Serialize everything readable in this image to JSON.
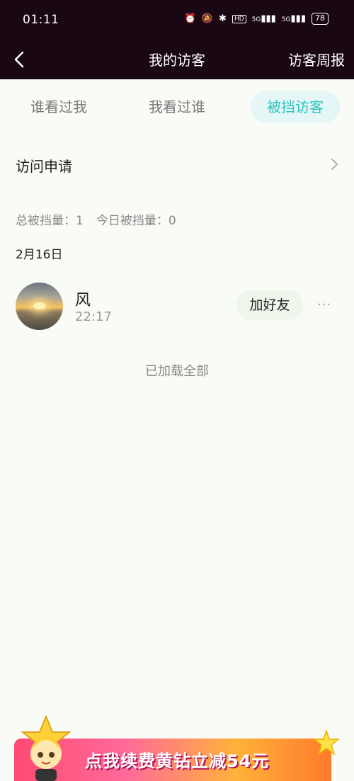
{
  "status_bar": {
    "time": "01:11",
    "network1": "5G",
    "network2": "5G",
    "battery": "78"
  },
  "nav": {
    "title": "我的访客",
    "right_label": "访客周报"
  },
  "tabs": [
    {
      "label": "谁看过我",
      "active": false
    },
    {
      "label": "我看过谁",
      "active": false
    },
    {
      "label": "被挡访客",
      "active": true
    }
  ],
  "request": {
    "label": "访问申请"
  },
  "stats": {
    "total": "总被挡量：1",
    "today": "今日被挡量：0"
  },
  "date_header": "2月16日",
  "visitor": {
    "name": "风",
    "time": "22:17",
    "add_label": "加好友",
    "more_label": "···"
  },
  "footer_text": "已加载全部",
  "banner": {
    "text": "点我续费黄钻立减54元"
  },
  "colors": {
    "header_bg": "#190713",
    "active_tab": "#2ec4c4",
    "active_tab_bg": "#e4f6f5",
    "page_bg": "#f8fbf6"
  }
}
